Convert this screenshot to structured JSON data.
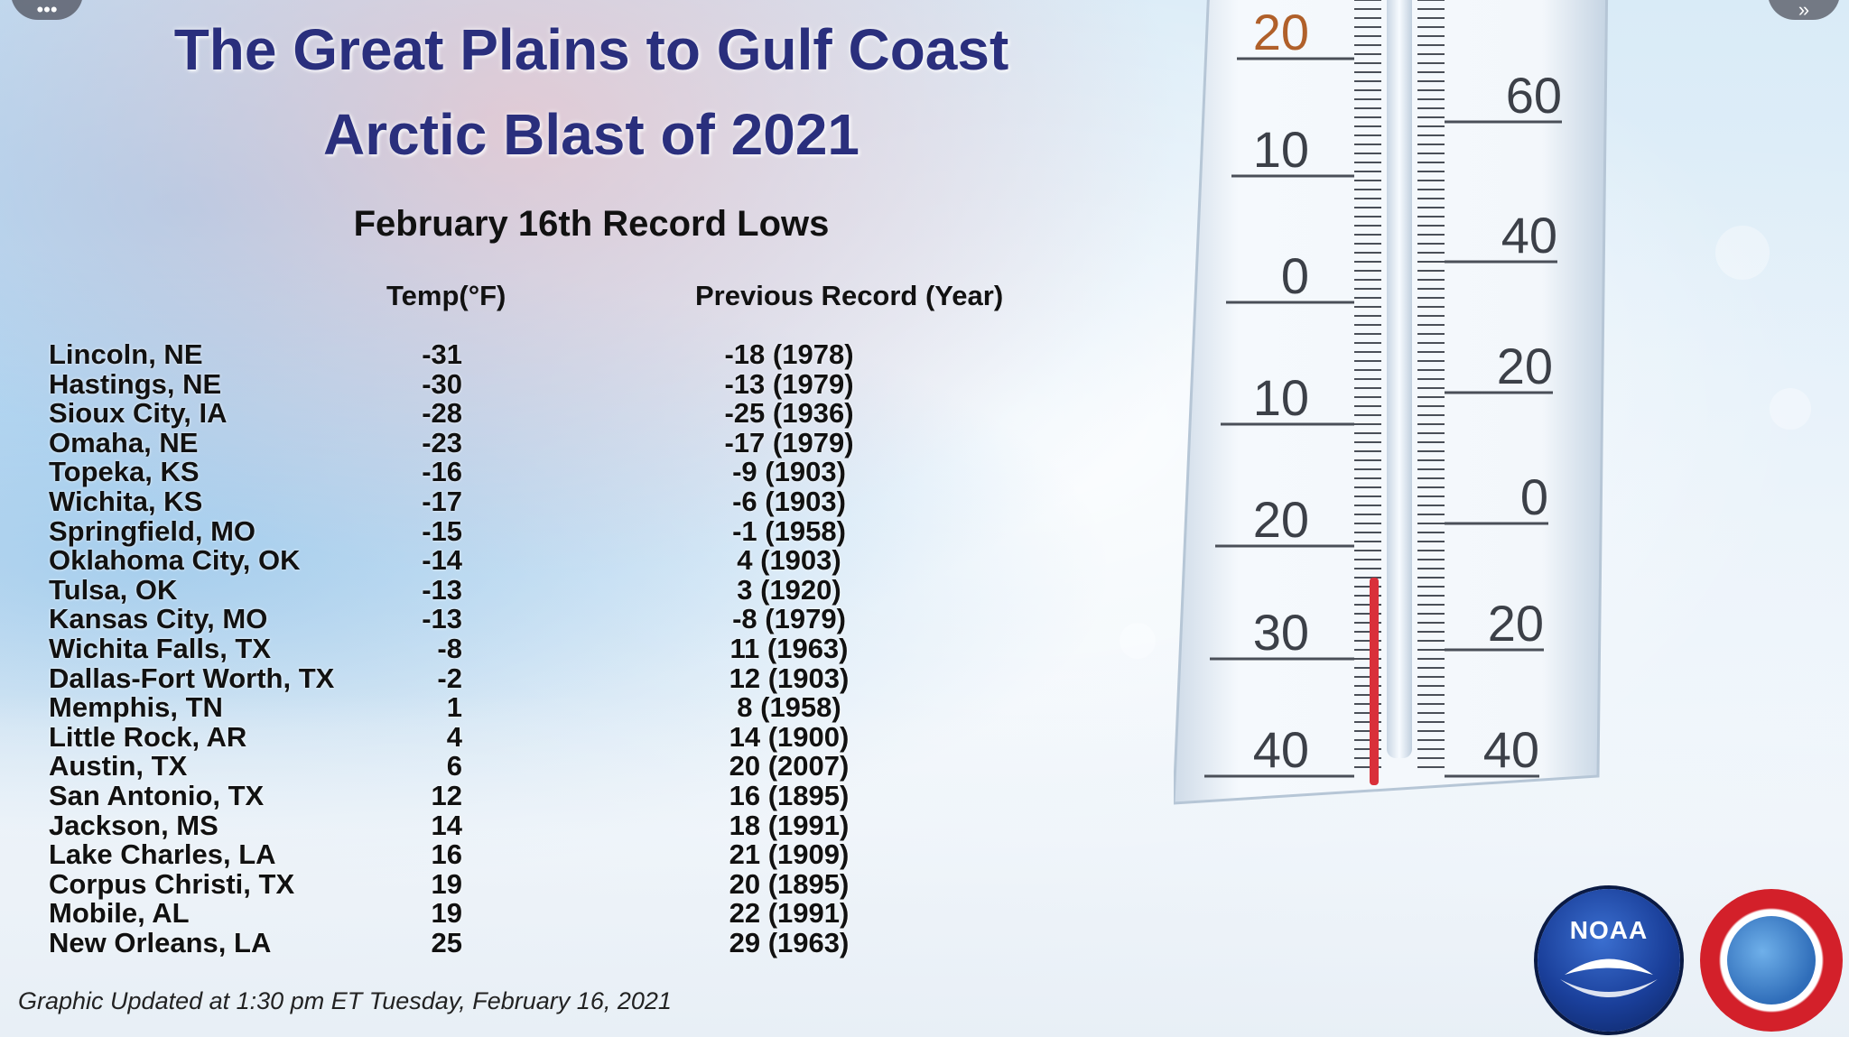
{
  "title": {
    "line1": "The Great Plains to Gulf Coast",
    "line2": "Arctic Blast of 2021"
  },
  "subtitle": "February 16th Record Lows",
  "columns": {
    "temp": "Temp(°F)",
    "previous": "Previous Record (Year)"
  },
  "rows": [
    {
      "city": "Lincoln, NE",
      "temp": "-31",
      "previous": "-18 (1978)"
    },
    {
      "city": "Hastings, NE",
      "temp": "-30",
      "previous": "-13 (1979)"
    },
    {
      "city": "Sioux City, IA",
      "temp": "-28",
      "previous": "-25 (1936)"
    },
    {
      "city": "Omaha, NE",
      "temp": "-23",
      "previous": "-17 (1979)"
    },
    {
      "city": "Topeka, KS",
      "temp": "-16",
      "previous": "-9 (1903)"
    },
    {
      "city": "Wichita, KS",
      "temp": "-17",
      "previous": "-6 (1903)"
    },
    {
      "city": "Springfield, MO",
      "temp": "-15",
      "previous": "-1 (1958)"
    },
    {
      "city": "Oklahoma City, OK",
      "temp": "-14",
      "previous": "4 (1903)"
    },
    {
      "city": "Tulsa, OK",
      "temp": "-13",
      "previous": "3 (1920)"
    },
    {
      "city": "Kansas City, MO",
      "temp": "-13",
      "previous": "-8 (1979)"
    },
    {
      "city": "Wichita Falls, TX",
      "temp": "-8",
      "previous": "11 (1963)"
    },
    {
      "city": "Dallas-Fort Worth, TX",
      "temp": "-2",
      "previous": "12 (1903)"
    },
    {
      "city": "Memphis, TN",
      "temp": "1",
      "previous": "8 (1958)"
    },
    {
      "city": "Little Rock, AR",
      "temp": "4",
      "previous": "14 (1900)"
    },
    {
      "city": "Austin, TX",
      "temp": "6",
      "previous": "20 (2007)"
    },
    {
      "city": "San Antonio, TX",
      "temp": "12",
      "previous": "16 (1895)"
    },
    {
      "city": "Jackson, MS",
      "temp": "14",
      "previous": "18 (1991)"
    },
    {
      "city": "Lake Charles, LA",
      "temp": "16",
      "previous": "21 (1909)"
    },
    {
      "city": "Corpus Christi, TX",
      "temp": "19",
      "previous": "20 (1895)"
    },
    {
      "city": "Mobile, AL",
      "temp": "19",
      "previous": "22 (1991)"
    },
    {
      "city": "New Orleans, LA",
      "temp": "25",
      "previous": "29 (1963)"
    }
  ],
  "footer": "Graphic Updated at 1:30 pm ET Tuesday, February 16, 2021",
  "thermometer": {
    "left_scale": [
      "20",
      "10",
      "0",
      "10",
      "20",
      "30",
      "40"
    ],
    "right_scale": [
      "60",
      "40",
      "20",
      "0",
      "20",
      "40"
    ]
  },
  "logos": {
    "noaa": "NOAA",
    "nws_ring": "NATIONAL WEATHER SERVICE"
  },
  "colors": {
    "title": "#2a2f7d",
    "mercury": "#d9303a"
  },
  "controls": {
    "left_icon": "dots-icon",
    "right_icon": "fast-forward-icon"
  }
}
